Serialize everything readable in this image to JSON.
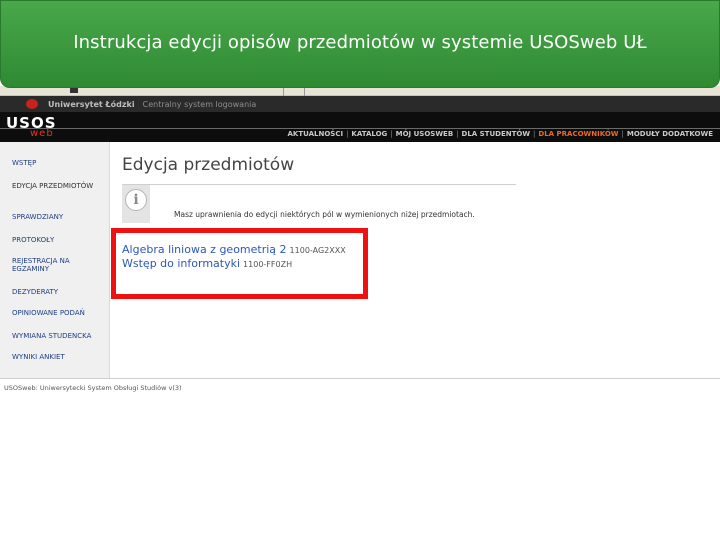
{
  "slide": {
    "title": "Instrukcja edycji opisów przedmiotów w systemie USOSweb UŁ",
    "banner_color": "#3c9a3f",
    "highlight_color": "#ee1111"
  },
  "browser_tab": {
    "university": "Uniwersytet Łódzki",
    "system": "Centralny system logowania"
  },
  "header": {
    "logo_usos": "USOS",
    "logo_web": "web",
    "nav": [
      {
        "label": "AKTUALNOŚCI"
      },
      {
        "label": "KATALOG"
      },
      {
        "label": "MÓJ USOSWEB"
      },
      {
        "label": "DLA STUDENTÓW"
      },
      {
        "label": "DLA PRACOWNIKÓW"
      },
      {
        "label": "MODUŁY DODATKOWE"
      }
    ],
    "nav_separator": "|",
    "active_color": "#e96a2a"
  },
  "sidebar": {
    "items": [
      {
        "label": "WSTĘP"
      },
      {
        "label": "EDYCJA PRZEDMIOTÓW"
      },
      {
        "label": "SPRAWDZIANY"
      },
      {
        "label": "PROTOKOŁY"
      },
      {
        "label": "REJESTRACJA NA EGZAMINY"
      },
      {
        "label": "DEZYDERATY"
      },
      {
        "label": "OPINIOWANE PODAŃ"
      },
      {
        "label": "WYMIANA STUDENCKA"
      },
      {
        "label": "WYNIKI ANKIET"
      }
    ]
  },
  "main": {
    "title": "Edycja przedmiotów",
    "info_icon": "info-icon",
    "info_text": "Masz uprawnienia do edycji niektórych pól w wymienionych niżej przedmiotach.",
    "courses": [
      {
        "name": "Algebra liniowa z geometrią 2",
        "code": "1100-AG2XXX"
      },
      {
        "name": "Wstęp do informatyki",
        "code": "1100-FF0ZH"
      }
    ]
  },
  "footer": {
    "text": "USOSweb: Uniwersytecki System Obsługi Studiów v(3)"
  }
}
